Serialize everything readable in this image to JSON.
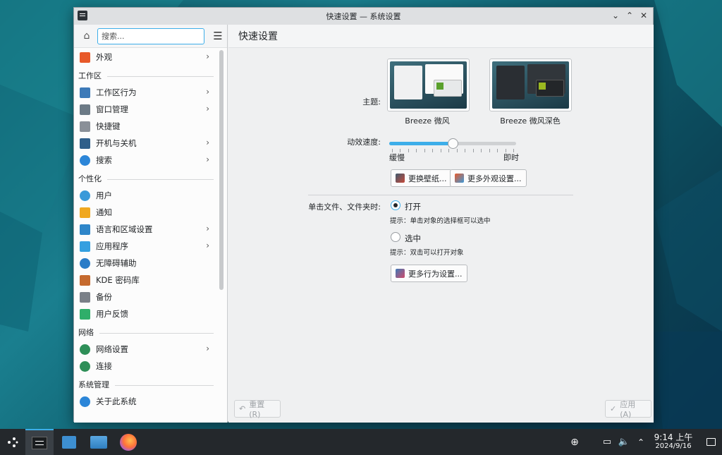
{
  "window": {
    "title": "快速设置 — 系统设置"
  },
  "sidebar": {
    "search_placeholder": "搜索...",
    "items": [
      {
        "label": "外观",
        "icon": "appearance-icon",
        "color": "#e85a2a",
        "arrow": true
      },
      {
        "header": "工作区"
      },
      {
        "label": "工作区行为",
        "icon": "workspace-icon",
        "color": "#3d7ab8",
        "arrow": true
      },
      {
        "label": "窗口管理",
        "icon": "window-icon",
        "color": "#6c7a86",
        "arrow": true
      },
      {
        "label": "快捷键",
        "icon": "keyboard-icon",
        "color": "#8a9098",
        "arrow": false
      },
      {
        "label": "开机与关机",
        "icon": "monitor-icon",
        "color": "#2f5f8a",
        "arrow": true
      },
      {
        "label": "搜索",
        "icon": "search-icon",
        "color": "#2c86d8",
        "arrow": true
      },
      {
        "header": "个性化"
      },
      {
        "label": "用户",
        "icon": "user-icon",
        "color": "#3a9ad9",
        "arrow": false
      },
      {
        "label": "通知",
        "icon": "bell-icon",
        "color": "#f0a820",
        "arrow": false
      },
      {
        "label": "语言和区域设置",
        "icon": "language-icon",
        "color": "#2e86c9",
        "arrow": true
      },
      {
        "label": "应用程序",
        "icon": "apps-icon",
        "color": "#35a0e0",
        "arrow": true
      },
      {
        "label": "无障碍辅助",
        "icon": "accessibility-icon",
        "color": "#2a7cc7",
        "arrow": false
      },
      {
        "label": "KDE 密码库",
        "icon": "wallet-icon",
        "color": "#c56a2e",
        "arrow": false
      },
      {
        "label": "备份",
        "icon": "backup-icon",
        "color": "#7a8088",
        "arrow": false
      },
      {
        "label": "用户反馈",
        "icon": "feedback-icon",
        "color": "#2fae6a",
        "arrow": false
      },
      {
        "header": "网络"
      },
      {
        "label": "网络设置",
        "icon": "globe-icon",
        "color": "#2e8f58",
        "arrow": true
      },
      {
        "label": "连接",
        "icon": "globe-icon",
        "color": "#2e8f58",
        "arrow": false
      },
      {
        "header": "系统管理"
      },
      {
        "label": "关于此系统",
        "icon": "info-icon",
        "color": "#2c86d8",
        "arrow": false
      }
    ]
  },
  "main": {
    "heading": "快速设置",
    "theme_label": "主题:",
    "themes": [
      {
        "name": "Breeze 微风",
        "bg": "#e8ebee"
      },
      {
        "name": "Breeze 微风深色",
        "bg": "#2a2e33"
      }
    ],
    "animation_label": "动效速度:",
    "animation_value": 0.5,
    "slow_label": "缓慢",
    "instant_label": "即时",
    "change_wallpaper_button": "更换壁纸...",
    "more_appearance_button": "更多外观设置...",
    "click_label": "单击文件、文件夹时:",
    "open_option": "打开",
    "open_hint": "提示：单击对象的选择框可以选中",
    "select_option": "选中",
    "select_hint": "提示：双击可以打开对象",
    "more_behavior_button": "更多行为设置...",
    "reset_button": "重置(R)",
    "apply_button": "应用(A)"
  },
  "taskbar": {
    "time": "9:14 上午",
    "date": "2024/9/16"
  },
  "colors": {
    "accent": "#3daee9",
    "taskbar": "#24282c"
  }
}
